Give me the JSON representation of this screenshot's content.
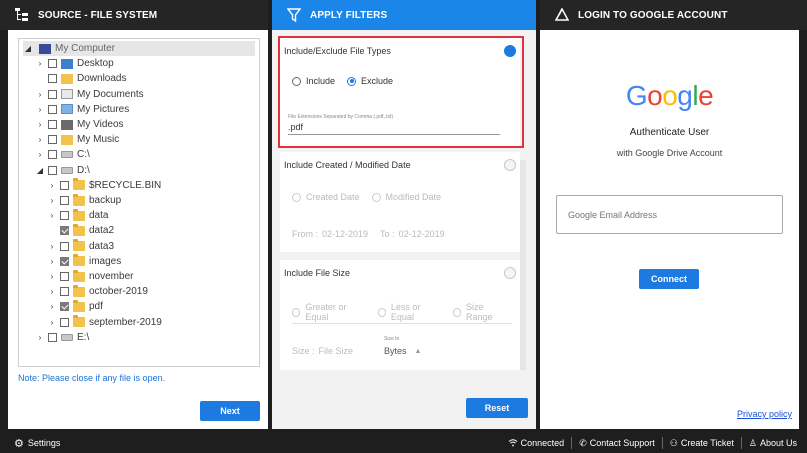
{
  "headers": {
    "source_title": "SOURCE - FILE SYSTEM",
    "filters_title": "APPLY FILTERS",
    "login_title": "LOGIN TO GOOGLE ACCOUNT"
  },
  "tree": {
    "items": [
      {
        "label": "My Computer",
        "depth": 0,
        "expander": "◢",
        "checkbox": false,
        "icon": "computer-icon"
      },
      {
        "label": "Desktop",
        "depth": 1,
        "expander": "›",
        "checkbox": true,
        "checked": false,
        "icon": "desktop-icon"
      },
      {
        "label": "Downloads",
        "depth": 1,
        "expander": "",
        "checkbox": true,
        "checked": false,
        "icon": "downloads-icon"
      },
      {
        "label": "My Documents",
        "depth": 1,
        "expander": "›",
        "checkbox": true,
        "checked": false,
        "icon": "documents-icon"
      },
      {
        "label": "My Pictures",
        "depth": 1,
        "expander": "›",
        "checkbox": true,
        "checked": false,
        "icon": "pictures-icon"
      },
      {
        "label": "My Videos",
        "depth": 1,
        "expander": "›",
        "checkbox": true,
        "checked": false,
        "icon": "videos-icon"
      },
      {
        "label": "My Music",
        "depth": 1,
        "expander": "›",
        "checkbox": true,
        "checked": false,
        "icon": "music-icon"
      },
      {
        "label": "C:\\",
        "depth": 1,
        "expander": "›",
        "checkbox": true,
        "checked": false,
        "icon": "drive-icon"
      },
      {
        "label": "D:\\",
        "depth": 1,
        "expander": "◢",
        "checkbox": true,
        "checked": false,
        "icon": "drive-icon"
      },
      {
        "label": "$RECYCLE.BIN",
        "depth": 2,
        "expander": "›",
        "checkbox": true,
        "checked": false,
        "icon": "folder-icon"
      },
      {
        "label": "backup",
        "depth": 2,
        "expander": "›",
        "checkbox": true,
        "checked": false,
        "icon": "folder-icon"
      },
      {
        "label": "data",
        "depth": 2,
        "expander": "›",
        "checkbox": true,
        "checked": false,
        "icon": "folder-icon"
      },
      {
        "label": "data2",
        "depth": 2,
        "expander": "",
        "checkbox": true,
        "checked": true,
        "icon": "folder-icon"
      },
      {
        "label": "data3",
        "depth": 2,
        "expander": "›",
        "checkbox": true,
        "checked": false,
        "icon": "folder-icon"
      },
      {
        "label": "images",
        "depth": 2,
        "expander": "›",
        "checkbox": true,
        "checked": true,
        "icon": "folder-icon"
      },
      {
        "label": "november",
        "depth": 2,
        "expander": "›",
        "checkbox": true,
        "checked": false,
        "icon": "folder-icon"
      },
      {
        "label": "october-2019",
        "depth": 2,
        "expander": "›",
        "checkbox": true,
        "checked": false,
        "icon": "folder-icon"
      },
      {
        "label": "pdf",
        "depth": 2,
        "expander": "›",
        "checkbox": true,
        "checked": true,
        "icon": "folder-icon"
      },
      {
        "label": "september-2019",
        "depth": 2,
        "expander": "›",
        "checkbox": true,
        "checked": false,
        "icon": "folder-icon"
      },
      {
        "label": "E:\\",
        "depth": 1,
        "expander": "›",
        "checkbox": true,
        "checked": false,
        "icon": "drive-icon"
      }
    ]
  },
  "source": {
    "note": "Note: Please close if any file is open.",
    "next_label": "Next"
  },
  "filters": {
    "file_types": {
      "title": "Include/Exclude File Types",
      "include_label": "Include",
      "exclude_label": "Exclude",
      "selected": "Exclude",
      "extensions_label": "File Extensions Separated by Comma (.pdf,.txt)",
      "extensions_value": ".pdf"
    },
    "date": {
      "title": "Include Created / Modified Date",
      "created_label": "Created Date",
      "modified_label": "Modified Date",
      "from_label": "From :",
      "from_value": "02-12-2019",
      "to_label": "To :",
      "to_value": "02-12-2019"
    },
    "size": {
      "title": "Include File Size",
      "greater_label": "Greater or Equal",
      "less_label": "Less or Equal",
      "range_label": "Size Range",
      "size_label": "Size :",
      "size_placeholder": "File Size",
      "size_in_label": "Size In",
      "unit_value": "Bytes"
    },
    "reset_label": "Reset"
  },
  "login": {
    "logo_letters": [
      "G",
      "o",
      "o",
      "g",
      "l",
      "e"
    ],
    "logo_colors": [
      "#4285f4",
      "#ea4335",
      "#fbbc05",
      "#4285f4",
      "#34a853",
      "#ea4335"
    ],
    "heading": "Authenticate User",
    "subheading": "with Google Drive Account",
    "email_placeholder": "Google Email Address",
    "connect_label": "Connect",
    "privacy_label": "Privacy policy"
  },
  "footer": {
    "settings_label": "Settings",
    "connected_label": "Connected",
    "support_label": "Contact Support",
    "ticket_label": "Create Ticket",
    "about_label": "About Us"
  },
  "colors": {
    "accent": "#1c7ae0",
    "header_blue": "#1c86e8",
    "highlight_red": "#e0323c",
    "dark_bg": "#1e1e1e"
  }
}
